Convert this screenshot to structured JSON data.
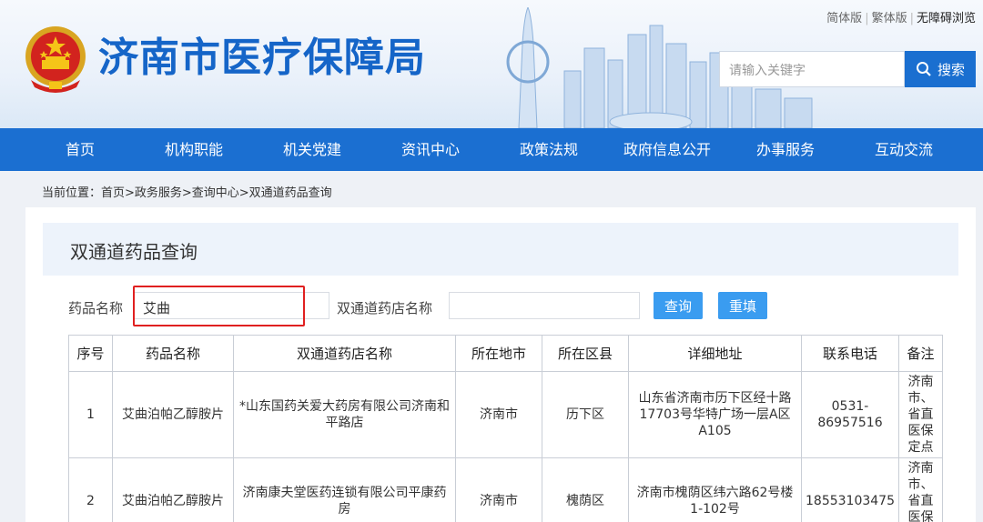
{
  "header": {
    "site_title": "济南市医疗保障局",
    "top_links": [
      "简体版",
      "繁体版",
      "无障碍浏览"
    ],
    "search": {
      "placeholder": "请输入关键字",
      "button_label": "搜索"
    }
  },
  "nav": {
    "items": [
      "首页",
      "机构职能",
      "机关党建",
      "资讯中心",
      "政策法规",
      "政府信息公开",
      "办事服务",
      "互动交流"
    ]
  },
  "breadcrumb": "当前位置：首页>政务服务>查询中心>双通道药品查询",
  "panel": {
    "title": "双通道药品查询",
    "form": {
      "drug_label": "药品名称",
      "drug_value": "艾曲",
      "pharmacy_label": "双通道药店名称",
      "pharmacy_value": "",
      "query_button": "查询",
      "reset_button": "重填"
    },
    "table": {
      "headers": [
        "序号",
        "药品名称",
        "双通道药店名称",
        "所在地市",
        "所在区县",
        "详细地址",
        "联系电话",
        "备注"
      ],
      "rows": [
        [
          "1",
          "艾曲泊帕乙醇胺片",
          "*山东国药关爱大药房有限公司济南和平路店",
          "济南市",
          "历下区",
          "山东省济南市历下区经十路17703号华特广场一层A区A105",
          "0531-86957516",
          "济南市、省直医保定点"
        ],
        [
          "2",
          "艾曲泊帕乙醇胺片",
          "济南康夫堂医药连锁有限公司平康药房",
          "济南市",
          "槐荫区",
          "济南市槐荫区纬六路62号楼1-102号",
          "18553103475",
          "济南市、省直医保定点"
        ]
      ]
    }
  },
  "colors": {
    "primary": "#1b6fd1",
    "title": "#1565c8",
    "button": "#3a9cf0",
    "highlight": "#e02020"
  }
}
